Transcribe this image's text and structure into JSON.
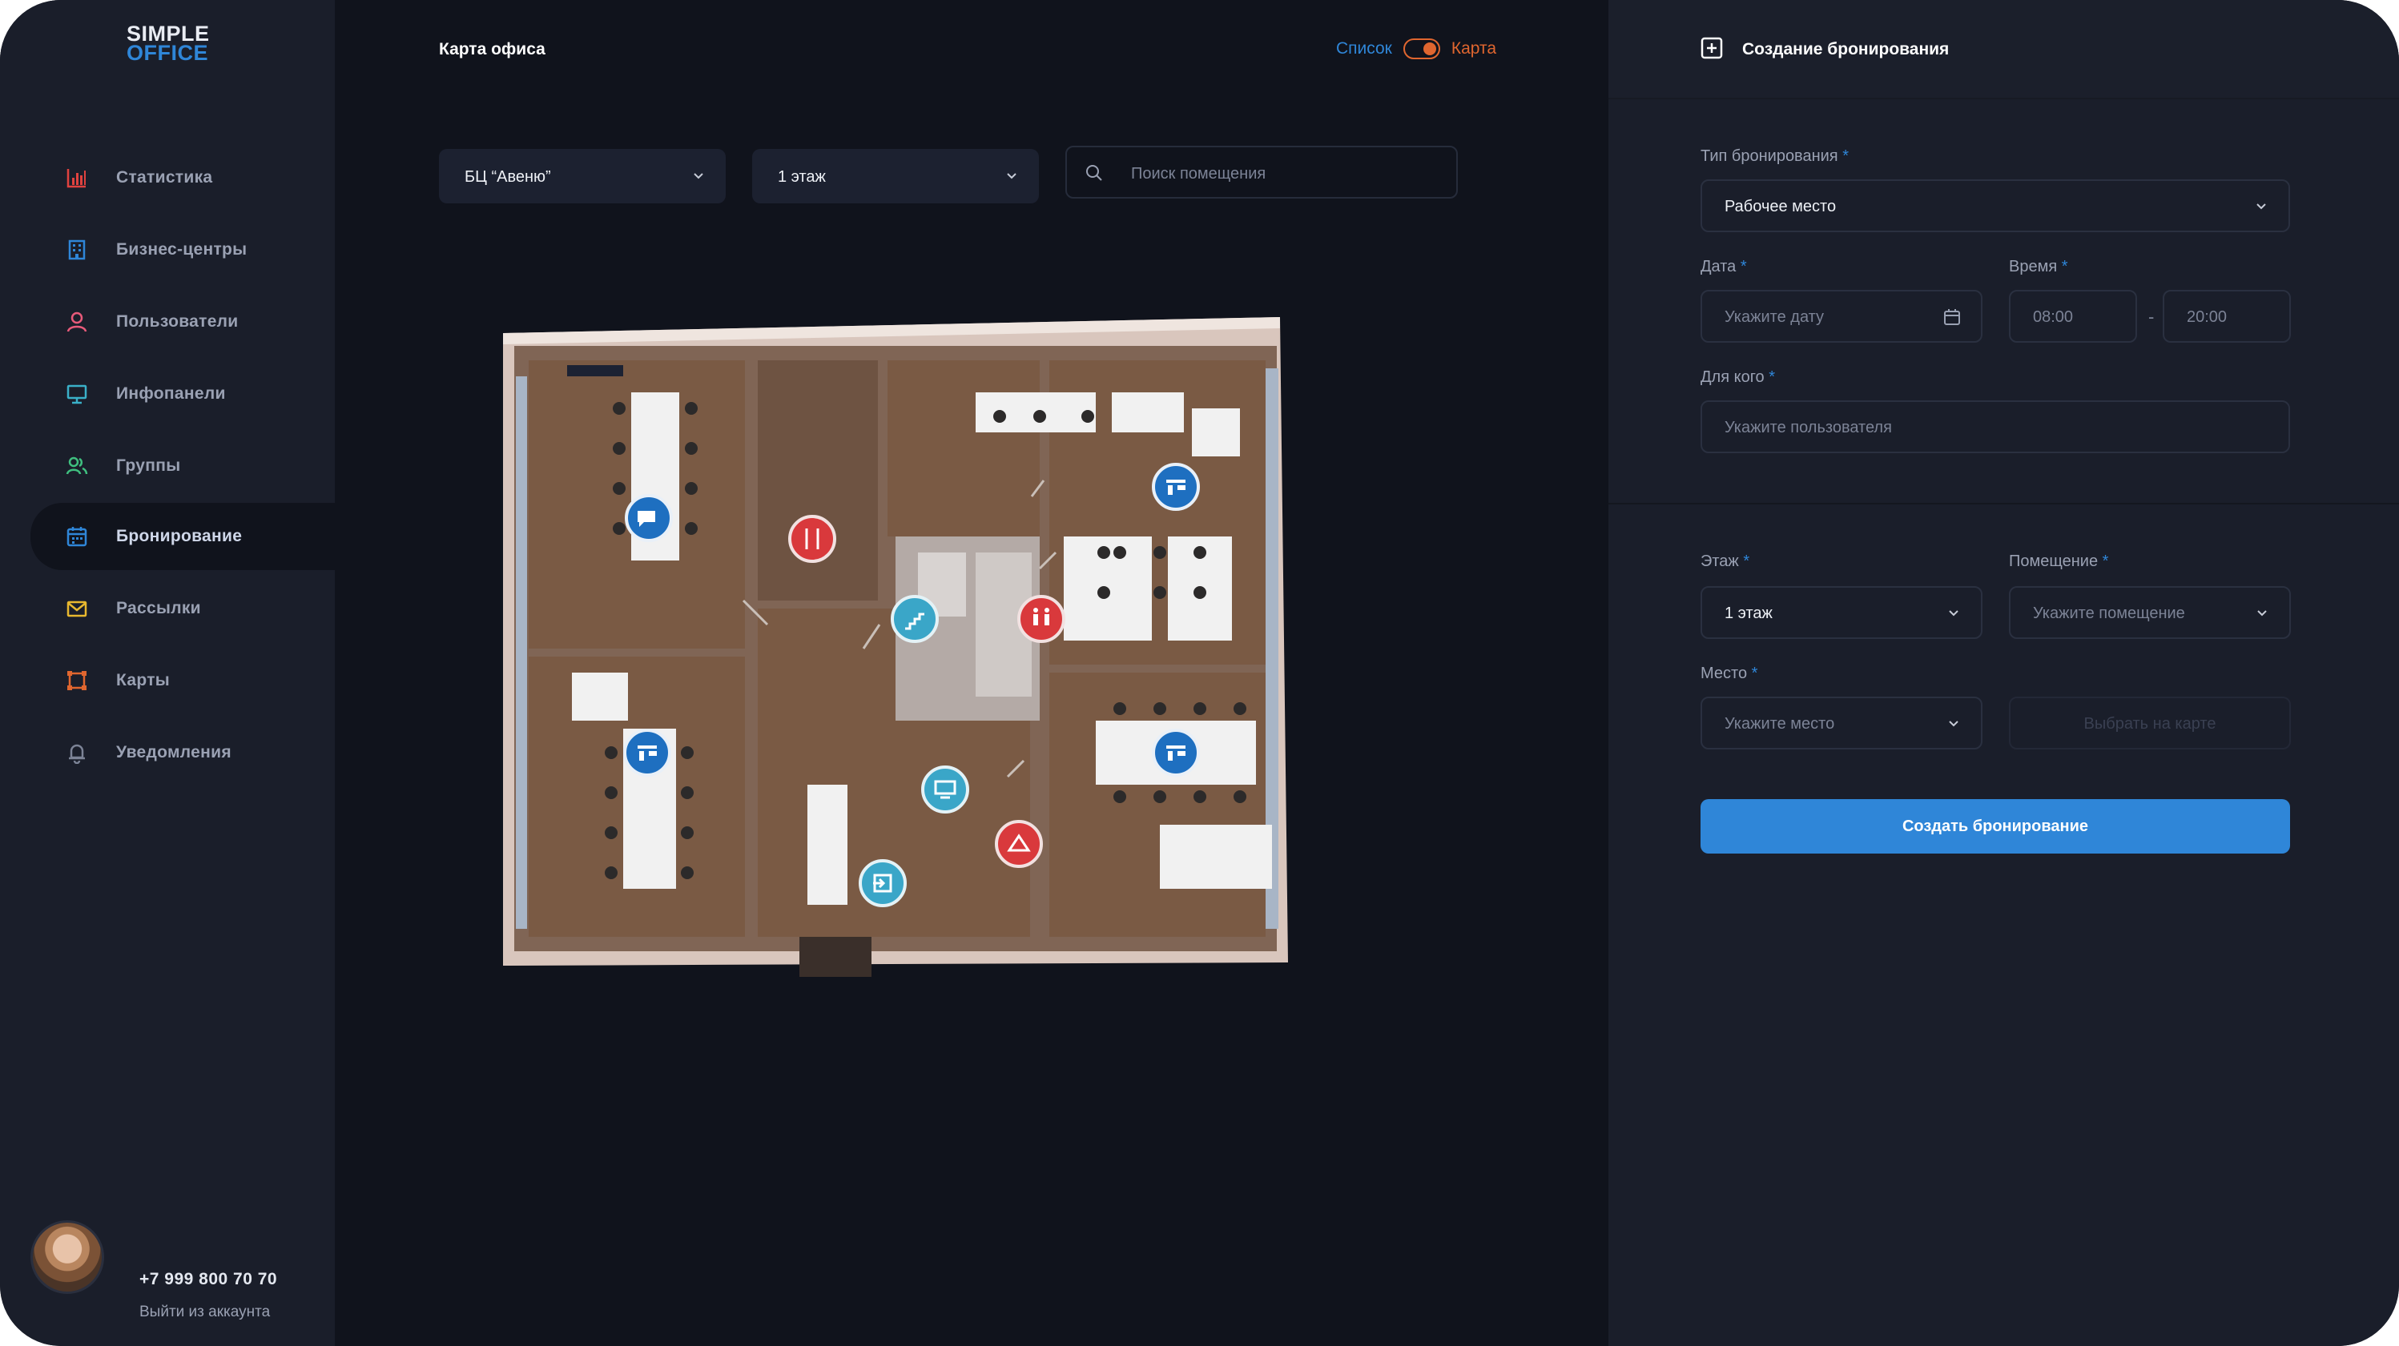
{
  "brand": {
    "line1": "SIMPLE",
    "line2": "OFFICE"
  },
  "sidebar": {
    "items": [
      {
        "label": "Статистика",
        "icon": "bar-chart-icon",
        "color": "#e0423f"
      },
      {
        "label": "Бизнес-центры",
        "icon": "building-icon",
        "color": "#2f86d8"
      },
      {
        "label": "Пользователи",
        "icon": "user-icon",
        "color": "#e85a7a"
      },
      {
        "label": "Инфопанели",
        "icon": "monitor-icon",
        "color": "#3ab0c8"
      },
      {
        "label": "Группы",
        "icon": "group-icon",
        "color": "#3fbf7f"
      },
      {
        "label": "Бронирование",
        "icon": "calendar-icon",
        "color": "#2f86d8",
        "active": true
      },
      {
        "label": "Рассылки",
        "icon": "mail-icon",
        "color": "#e8b82f"
      },
      {
        "label": "Карты",
        "icon": "map-frame-icon",
        "color": "#e0662f"
      },
      {
        "label": "Уведомления",
        "icon": "bell-icon",
        "color": "#7c8396"
      }
    ],
    "user": {
      "phone": "+7 999 800 70 70",
      "logout": "Выйти из аккаунта"
    }
  },
  "main": {
    "title": "Карта офиса",
    "view_toggle": {
      "list": "Список",
      "map": "Карта",
      "active": "map"
    },
    "filters": {
      "business_center": "БЦ “Авеню”",
      "floor": "1 этаж",
      "search_placeholder": "Поиск помещения"
    },
    "map_markers": [
      {
        "icon": "chat-icon",
        "color": "#1e6fc0"
      },
      {
        "icon": "cafe-icon",
        "color": "#d9393c"
      },
      {
        "icon": "stairs-icon",
        "color": "#3aa6c8"
      },
      {
        "icon": "restroom-icon",
        "color": "#d9393c"
      },
      {
        "icon": "workplace-icon",
        "color": "#1e6fc0"
      },
      {
        "icon": "workplace-icon",
        "color": "#1e6fc0"
      },
      {
        "icon": "workplace-icon",
        "color": "#1e6fc0"
      },
      {
        "icon": "infopanel-icon",
        "color": "#3aa6c8"
      },
      {
        "icon": "wardrobe-icon",
        "color": "#d9393c"
      },
      {
        "icon": "entrance-icon",
        "color": "#3aa6c8"
      }
    ]
  },
  "panel": {
    "title": "Создание бронирования",
    "fields": {
      "booking_type": {
        "label": "Тип бронирования",
        "value": "Рабочее место"
      },
      "date": {
        "label": "Дата",
        "placeholder": "Укажите дату"
      },
      "time": {
        "label": "Время",
        "from": "08:00",
        "separator": "-",
        "to": "20:00"
      },
      "for_whom": {
        "label": "Для кого",
        "placeholder": "Укажите пользователя"
      },
      "floor": {
        "label": "Этаж",
        "value": "1 этаж"
      },
      "room": {
        "label": "Помещение",
        "placeholder": "Укажите помещение"
      },
      "place": {
        "label": "Место",
        "placeholder": "Укажите место"
      },
      "choose_on_map": "Выбрать на карте"
    },
    "required_mark": "*",
    "submit": "Создать бронирование"
  }
}
